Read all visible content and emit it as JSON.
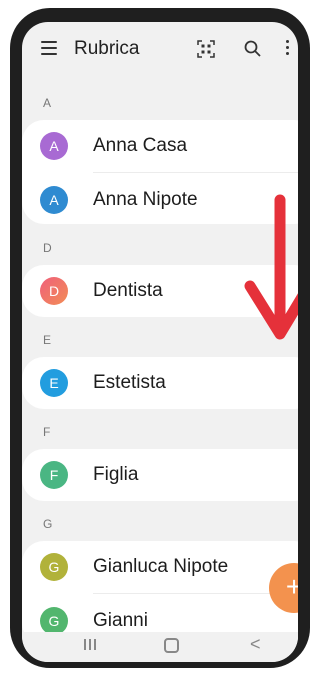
{
  "appbar": {
    "title": "Rubrica",
    "icons": [
      "menu-icon",
      "qr-scan-icon",
      "search-icon",
      "more-vert-icon"
    ]
  },
  "sections": [
    {
      "letter": "A",
      "contacts": [
        {
          "initial": "A",
          "name": "Anna Casa",
          "color": "#a86ad3"
        },
        {
          "initial": "A",
          "name": "Anna Nipote",
          "color": "#2f8bd1"
        }
      ]
    },
    {
      "letter": "D",
      "contacts": [
        {
          "initial": "D",
          "name": "Dentista",
          "color": "#ee6a73"
        }
      ]
    },
    {
      "letter": "E",
      "contacts": [
        {
          "initial": "E",
          "name": "Estetista",
          "color": "#229ddf"
        }
      ]
    },
    {
      "letter": "F",
      "contacts": [
        {
          "initial": "F",
          "name": "Figlia",
          "color": "#4ab683"
        }
      ]
    },
    {
      "letter": "G",
      "contacts": [
        {
          "initial": "G",
          "name": "Gianluca Nipote",
          "color": "#b1b23a"
        },
        {
          "initial": "G",
          "name": "Gianni",
          "color": "#52b66e"
        }
      ]
    }
  ],
  "fab": {
    "label": "+",
    "color": "#f3924e"
  },
  "overlay": {
    "arrow_color": "#e5313a",
    "arrow_direction": "down"
  },
  "navbar": {
    "icons": [
      "recents-icon",
      "home-icon",
      "back-icon"
    ],
    "back_glyph": "<"
  }
}
